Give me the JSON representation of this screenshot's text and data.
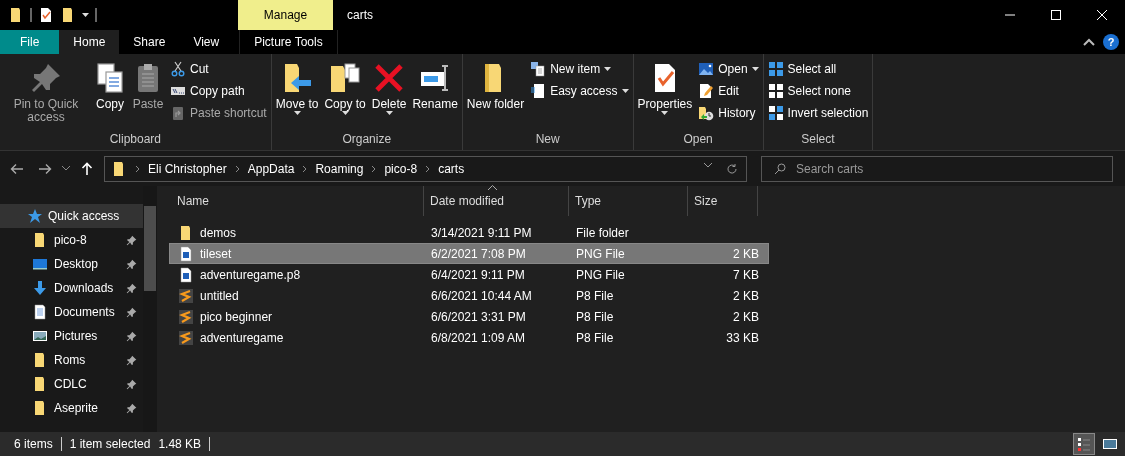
{
  "window": {
    "title": "carts",
    "context_tab": "Manage",
    "help": "?"
  },
  "tabs": [
    {
      "label": "File",
      "kind": "file",
      "selected": false
    },
    {
      "label": "Home",
      "kind": "tab",
      "selected": true
    },
    {
      "label": "Share",
      "kind": "tab",
      "selected": false
    },
    {
      "label": "View",
      "kind": "tab",
      "selected": false
    },
    {
      "label": "Picture Tools",
      "kind": "context",
      "selected": false
    }
  ],
  "ribbon": [
    {
      "name": "Clipboard",
      "large": [
        {
          "label": "Pin to Quick access",
          "kind": "pin",
          "dropdown": false,
          "disabled": true
        },
        {
          "label": "Copy",
          "kind": "copy",
          "dropdown": false,
          "disabled": false
        },
        {
          "label": "Paste",
          "kind": "paste",
          "dropdown": false,
          "disabled": true
        }
      ],
      "small": [
        {
          "label": "Cut",
          "kind": "cut",
          "dropdown": false,
          "disabled": false
        },
        {
          "label": "Copy path",
          "kind": "path",
          "dropdown": false,
          "disabled": false
        },
        {
          "label": "Paste shortcut",
          "kind": "pasteshortcut",
          "dropdown": false,
          "disabled": true
        }
      ]
    },
    {
      "name": "Organize",
      "large": [
        {
          "label": "Move to",
          "kind": "move",
          "dropdown": true,
          "disabled": false
        },
        {
          "label": "Copy to",
          "kind": "copyto",
          "dropdown": true,
          "disabled": false
        },
        {
          "label": "Delete",
          "kind": "delete",
          "dropdown": true,
          "disabled": false
        },
        {
          "label": "Rename",
          "kind": "rename",
          "dropdown": false,
          "disabled": false
        }
      ]
    },
    {
      "name": "New",
      "large": [
        {
          "label": "New folder",
          "kind": "newfolder",
          "dropdown": false,
          "disabled": false
        }
      ],
      "small": [
        {
          "label": "New item",
          "kind": "newitem",
          "dropdown": true,
          "disabled": false
        },
        {
          "label": "Easy access",
          "kind": "easyaccess",
          "dropdown": true,
          "disabled": false
        }
      ]
    },
    {
      "name": "Open",
      "large": [
        {
          "label": "Properties",
          "kind": "properties",
          "dropdown": true,
          "disabled": false
        }
      ],
      "small": [
        {
          "label": "Open",
          "kind": "open",
          "dropdown": true,
          "disabled": false
        },
        {
          "label": "Edit",
          "kind": "edit",
          "dropdown": false,
          "disabled": false
        },
        {
          "label": "History",
          "kind": "history",
          "dropdown": false,
          "disabled": false
        }
      ]
    },
    {
      "name": "Select",
      "small": [
        {
          "label": "Select all",
          "kind": "selectall",
          "dropdown": false,
          "disabled": false
        },
        {
          "label": "Select none",
          "kind": "selectnone",
          "dropdown": false,
          "disabled": false
        },
        {
          "label": "Invert selection",
          "kind": "invert",
          "dropdown": false,
          "disabled": false
        }
      ]
    }
  ],
  "address": {
    "path": [
      "Eli Christopher",
      "AppData",
      "Roaming",
      "pico-8",
      "carts"
    ]
  },
  "search": {
    "placeholder": "Search carts"
  },
  "sidebar": {
    "items": [
      {
        "label": "Quick access",
        "kind": "star",
        "pinned": false,
        "selected": true
      },
      {
        "label": "pico-8",
        "kind": "folder",
        "pinned": true,
        "selected": false
      },
      {
        "label": "Desktop",
        "kind": "desktop",
        "pinned": true,
        "selected": false
      },
      {
        "label": "Downloads",
        "kind": "downloads",
        "pinned": true,
        "selected": false
      },
      {
        "label": "Documents",
        "kind": "documents",
        "pinned": true,
        "selected": false
      },
      {
        "label": "Pictures",
        "kind": "pictures",
        "pinned": true,
        "selected": false
      },
      {
        "label": "Roms",
        "kind": "folder",
        "pinned": true,
        "selected": false
      },
      {
        "label": "CDLC",
        "kind": "folder",
        "pinned": true,
        "selected": false
      },
      {
        "label": "Aseprite",
        "kind": "folder",
        "pinned": true,
        "selected": false
      }
    ]
  },
  "table": {
    "columns": [
      {
        "label": "Name",
        "sorted": false
      },
      {
        "label": "Date modified",
        "sorted": true
      },
      {
        "label": "Type",
        "sorted": false
      },
      {
        "label": "Size",
        "sorted": false
      }
    ],
    "rows": [
      {
        "name": "demos",
        "date": "3/14/2021 9:11 PM",
        "type": "File folder",
        "kind": "folder",
        "selected": false
      },
      {
        "name": "tileset",
        "date": "6/2/2021 7:08 PM",
        "type": "PNG File",
        "size": "2 KB",
        "kind": "image",
        "selected": true
      },
      {
        "name": "adventuregame.p8",
        "date": "6/4/2021 9:11 PM",
        "type": "PNG File",
        "size": "7 KB",
        "kind": "image",
        "selected": false
      },
      {
        "name": "untitled",
        "date": "6/6/2021 10:44 AM",
        "type": "P8 File",
        "size": "2 KB",
        "kind": "script",
        "selected": false
      },
      {
        "name": "pico beginner",
        "date": "6/6/2021 3:31 PM",
        "type": "P8 File",
        "size": "2 KB",
        "kind": "script",
        "selected": false
      },
      {
        "name": "adventuregame",
        "date": "6/8/2021 1:09 AM",
        "type": "P8 File",
        "size": "33 KB",
        "kind": "script",
        "selected": false
      }
    ]
  },
  "status_bar": {
    "items": "6 items",
    "selection": "1 item selected",
    "size": "1.48 KB",
    "views": [
      {
        "kind": "details",
        "selected": true
      },
      {
        "kind": "large",
        "selected": false
      }
    ]
  }
}
